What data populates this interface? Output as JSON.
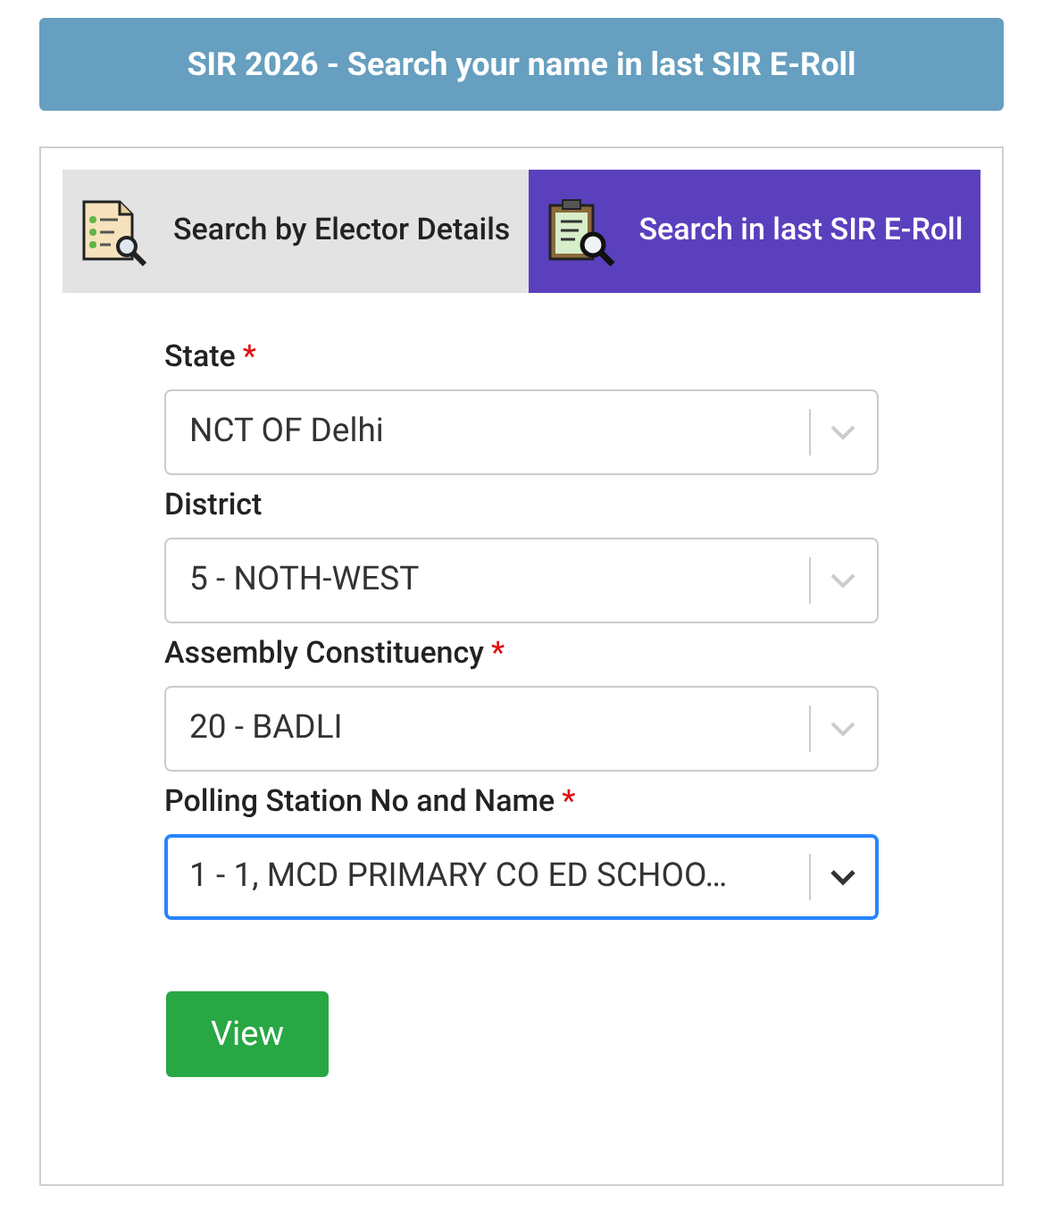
{
  "header": {
    "title": "SIR 2026 - Search your name in last SIR E-Roll"
  },
  "tabs": [
    {
      "label": "Search by Elector Details",
      "selected": false,
      "kind": "elector"
    },
    {
      "label": "Search in last SIR E-Roll",
      "selected": true,
      "kind": "roll"
    }
  ],
  "fields": [
    {
      "label": "State",
      "required_mark": "*",
      "value": "NCT OF Delhi",
      "focused": false
    },
    {
      "label": "District",
      "value": "5 - NOTH-WEST",
      "focused": false
    },
    {
      "label": "Assembly Constituency",
      "required_mark": "*",
      "value": "20 - BADLI",
      "focused": false
    },
    {
      "label": "Polling Station No and Name",
      "required_mark": "*",
      "value": "1 - 1, MCD PRIMARY CO ED SCHOO…",
      "focused": true
    }
  ],
  "view_button": {
    "label": "View"
  }
}
